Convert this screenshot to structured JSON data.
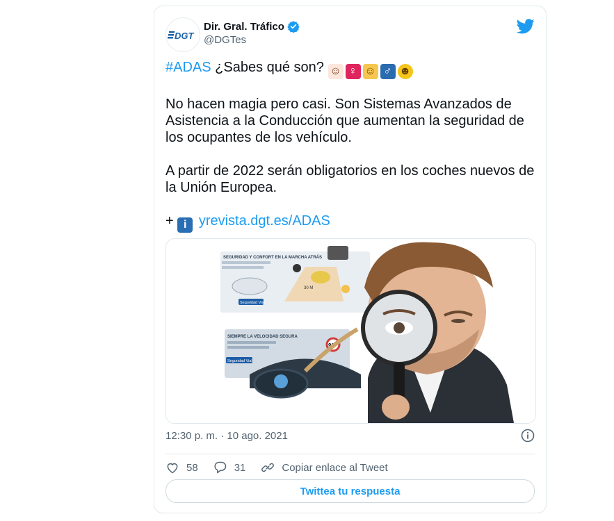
{
  "tweet": {
    "author_name": "Dir. Gral. Tráfico",
    "handle": "@DGTes",
    "avatar_text": "DGT",
    "hashtag": "#ADAS",
    "line1_rest": " ¿Sabes qué son?",
    "paragraph2": "No hacen magia pero casi. Son Sistemas Avanzados de Asistencia a la Conducción que aumentan la seguridad de los ocupantes de los vehículo.",
    "paragraph3": "A partir de 2022 serán obligatorios en los coches nuevos de la Unión Europea.",
    "link_prefix": "+",
    "link_text": "yrevista.dgt.es/ADAS",
    "timestamp": "12:30 p. m. · 10 ago. 2021"
  },
  "media": {
    "infographic_title_1": "SEGURIDAD Y CONFORT EN LA MARCHA ATRÁS",
    "infographic_title_2": "SIEMPRE LA VELOCIDAD SEGURA",
    "badge_1": "Seguridad Vial",
    "badge_2": "Seguridad Vial",
    "speed_sign": "90",
    "distance_label": "30 M"
  },
  "actions": {
    "likes": "58",
    "replies": "31",
    "copy_link": "Copiar enlace al Tweet",
    "reply_button": "Twittea tu respuesta"
  },
  "colors": {
    "accent": "#1d9bf0",
    "verified": "#1d9bf0",
    "muted": "#536471"
  }
}
